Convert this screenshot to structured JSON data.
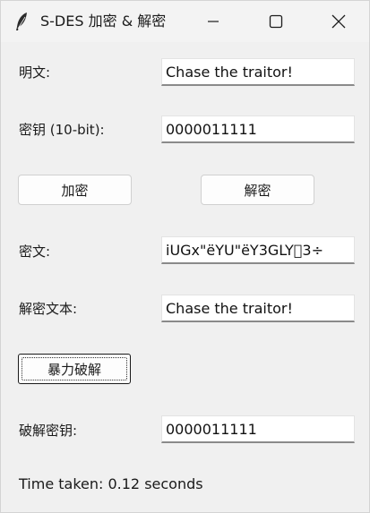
{
  "window": {
    "title": "S-DES 加密 & 解密",
    "title_icon": "feather-icon",
    "controls": {
      "minimize": "minimize-icon",
      "maximize": "maximize-icon",
      "close": "close-icon"
    }
  },
  "form": {
    "plaintext_label": "明文:",
    "plaintext_value": "Chase the traitor!",
    "key_label": "密钥 (10-bit):",
    "key_value": "0000011111",
    "encrypt_button": "加密",
    "decrypt_button": "解密",
    "ciphertext_label": "密文:",
    "ciphertext_value": "iUGx\"ëYU\"ëY3GLY\u00003÷",
    "decrypted_label": "解密文本:",
    "decrypted_value": "Chase the traitor!",
    "bruteforce_button": "暴力破解",
    "cracked_key_label": "破解密钥:",
    "cracked_key_value": "0000011111"
  },
  "status": {
    "time_text": "Time taken: 0.12 seconds"
  }
}
